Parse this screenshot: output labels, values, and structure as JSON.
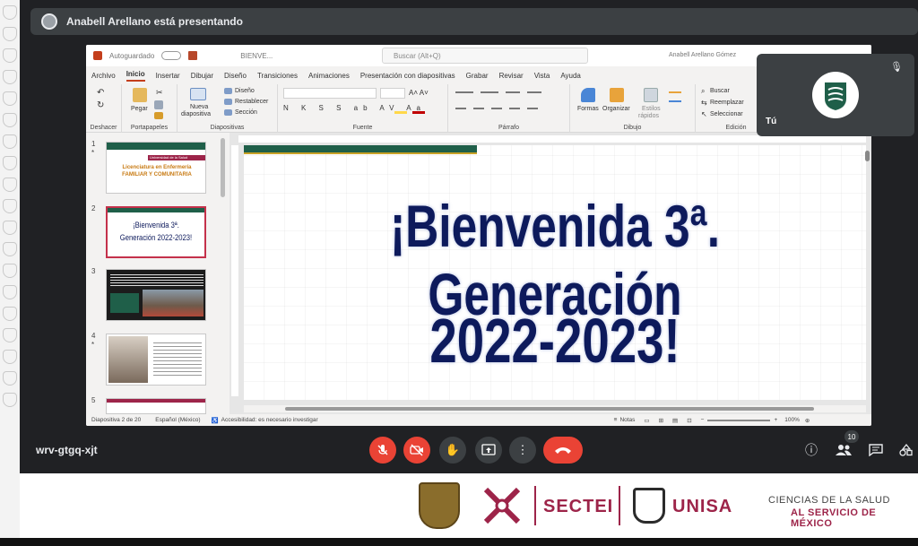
{
  "meet": {
    "presenter_text": "Anabell Arellano está presentando",
    "meeting_code": "wrv-gtgq-xjt",
    "self_name": "Tú",
    "participants_count": "10"
  },
  "ppt": {
    "autosave": "Autoguardado",
    "doc_name": "BIENVE...",
    "search_placeholder": "Buscar (Alt+Q)",
    "user_name": "Anabell Arellano Gómez",
    "menu": [
      "Archivo",
      "Inicio",
      "Insertar",
      "Dibujar",
      "Diseño",
      "Transiciones",
      "Animaciones",
      "Presentación con diapositivas",
      "Grabar",
      "Revisar",
      "Vista",
      "Ayuda"
    ],
    "ribbon": {
      "deshacer": "Deshacer",
      "pegar": "Pegar",
      "portapapeles": "Portapapeles",
      "nueva": "Nueva",
      "diapositiva": "diapositiva",
      "diseno": "Diseño",
      "restablecer": "Restablecer",
      "seccion": "Sección",
      "diapositivas": "Diapositivas",
      "fuente": "Fuente",
      "parrafo": "Párrafo",
      "formas": "Formas",
      "organizar": "Organizar",
      "estilos": "Estilos",
      "rapidos": "rápidos",
      "dibujo": "Dibujo",
      "buscar": "Buscar",
      "reemplazar": "Reemplazar",
      "seleccionar": "Seleccionar",
      "edicion": "Edición"
    },
    "slide": {
      "line1": "¡Bienvenida 3ª. Generación",
      "line2": "2022-2023!"
    },
    "thumbnails": {
      "t1_header": "Universidad de la Salud",
      "t1_title": "Licenciatura en Enfermería FAMILIAR Y COMUNITARIA",
      "t2_text": "¡Bienvenida 3ª. Generación 2022-2023!"
    },
    "status": {
      "slide_count": "Diapositiva 2 de 20",
      "language": "Español (México)",
      "accessibility": "Accesibilidad: es necesario investigar",
      "notes": "Notas",
      "zoom": "100%"
    }
  },
  "footer": {
    "sectei": "SECTEI",
    "unisa": "UNISA",
    "tagline1": "CIENCIAS DE LA SALUD",
    "tagline2": "AL SERVICIO DE MÉXICO"
  },
  "colors": {
    "accent_red": "#ea4335",
    "brand_wine": "#9d2449",
    "slide_text": "#0d1a5c",
    "slide_green": "#1f5f49"
  }
}
